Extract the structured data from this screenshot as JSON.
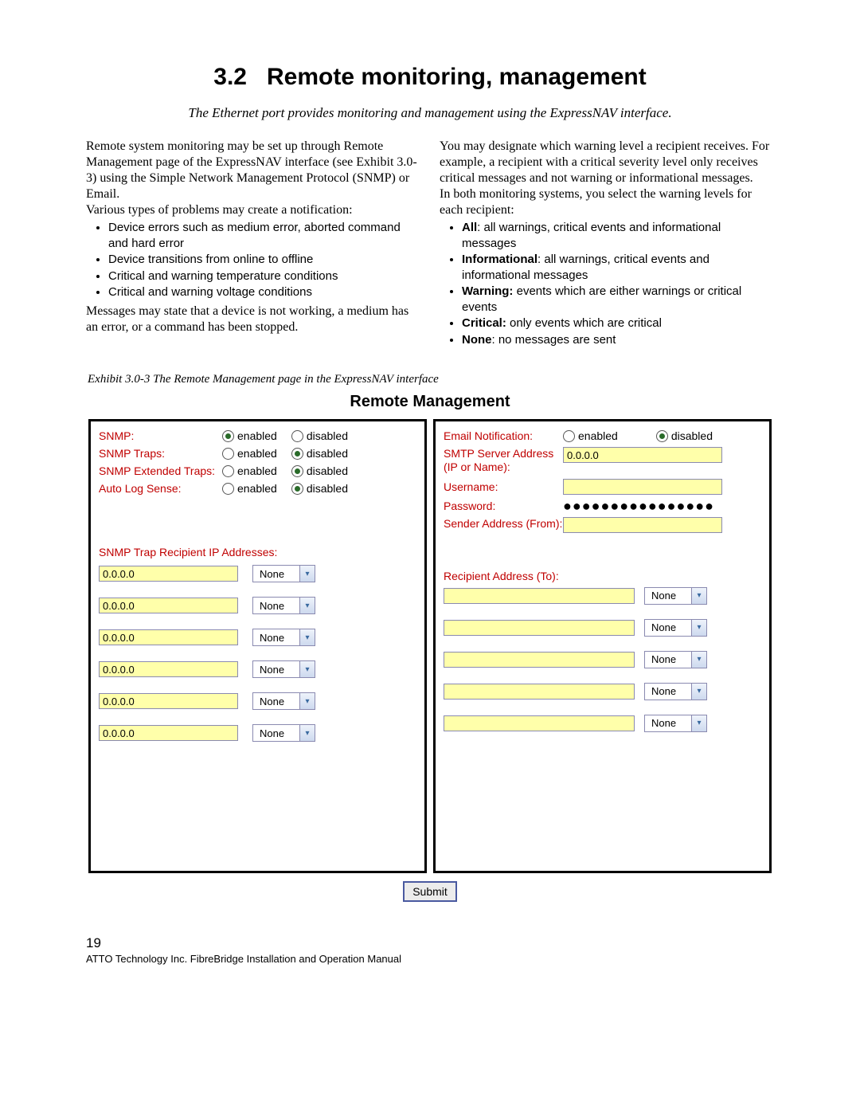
{
  "heading_num": "3.2",
  "heading_text": "Remote monitoring, management",
  "subhead": "The Ethernet port provides monitoring and management using the ExpressNAV interface.",
  "left": {
    "p1": "Remote system monitoring may be set up through Remote Management page of the ExpressNAV interface (see Exhibit 3.0-3) using the Simple Network Management Protocol (SNMP) or Email.",
    "p2": "Various types of problems may create a notification:",
    "bullets": [
      "Device errors such as medium error, aborted command and hard error",
      "Device transitions from online to offline",
      "Critical and warning temperature conditions",
      "Critical and warning voltage conditions"
    ],
    "p3": "Messages may state that a device is not working, a medium has an error, or a command has been stopped."
  },
  "right": {
    "p1": "You may designate which warning level a recipient receives. For example, a recipient with a critical severity level only receives critical messages and not warning or informational messages.",
    "p2": "In both monitoring systems, you select the warning levels for each recipient:",
    "bullets": [
      {
        "b": "All",
        "t": ": all warnings, critical events and informational messages"
      },
      {
        "b": "Informational",
        "t": ": all warnings, critical events and informational messages"
      },
      {
        "b": "Warning:",
        "t": " events which are either warnings or critical events"
      },
      {
        "b": "Critical:",
        "t": " only events which are critical"
      },
      {
        "b": "None",
        "t": ": no messages are sent"
      }
    ]
  },
  "exhibit": "Exhibit 3.0-3    The Remote Management page in the ExpressNAV interface",
  "panel_title": "Remote Management",
  "labels": {
    "enabled": "enabled",
    "disabled": "disabled",
    "snmp": "SNMP:",
    "snmp_traps": "SNMP Traps:",
    "snmp_ext": "SNMP Extended Traps:",
    "autolog": "Auto Log Sense:",
    "trap_recip_hdr": "SNMP Trap Recipient IP Addresses:",
    "email_notif": "Email Notification:",
    "smtp": "SMTP Server Address (IP or Name):",
    "username": "Username:",
    "password": "Password:",
    "sender": "Sender Address (From):",
    "recip_hdr": "Recipient Address (To):",
    "default_ip": "0.0.0.0",
    "default_sel": "None",
    "submit": "Submit"
  },
  "page_number": "19",
  "footer_src": "ATTO Technology Inc. FibreBridge Installation and Operation Manual"
}
